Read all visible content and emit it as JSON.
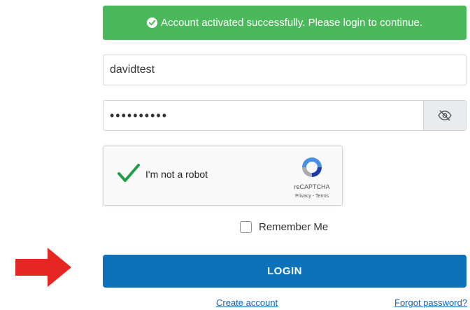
{
  "alert": {
    "message": "Account activated successfully. Please login to continue.",
    "icon": "check-circle-icon",
    "color": "#4cb85c"
  },
  "login_form": {
    "username_value": "davidtest",
    "password_masked": "••••••••••",
    "toggle_icon": "eye-slash-icon"
  },
  "recaptcha": {
    "label": "I'm not a robot",
    "brand": "reCAPTCHA",
    "privacy": "Privacy",
    "separator": " - ",
    "terms": "Terms",
    "checked": true
  },
  "remember_me": {
    "label": "Remember Me",
    "checked": false
  },
  "login_button": {
    "label": "LOGIN",
    "color": "#0d72b9"
  },
  "links": {
    "create_account": "Create account",
    "forgot_password": "Forgot password?"
  },
  "annotation": {
    "arrow_color": "#e52521"
  }
}
